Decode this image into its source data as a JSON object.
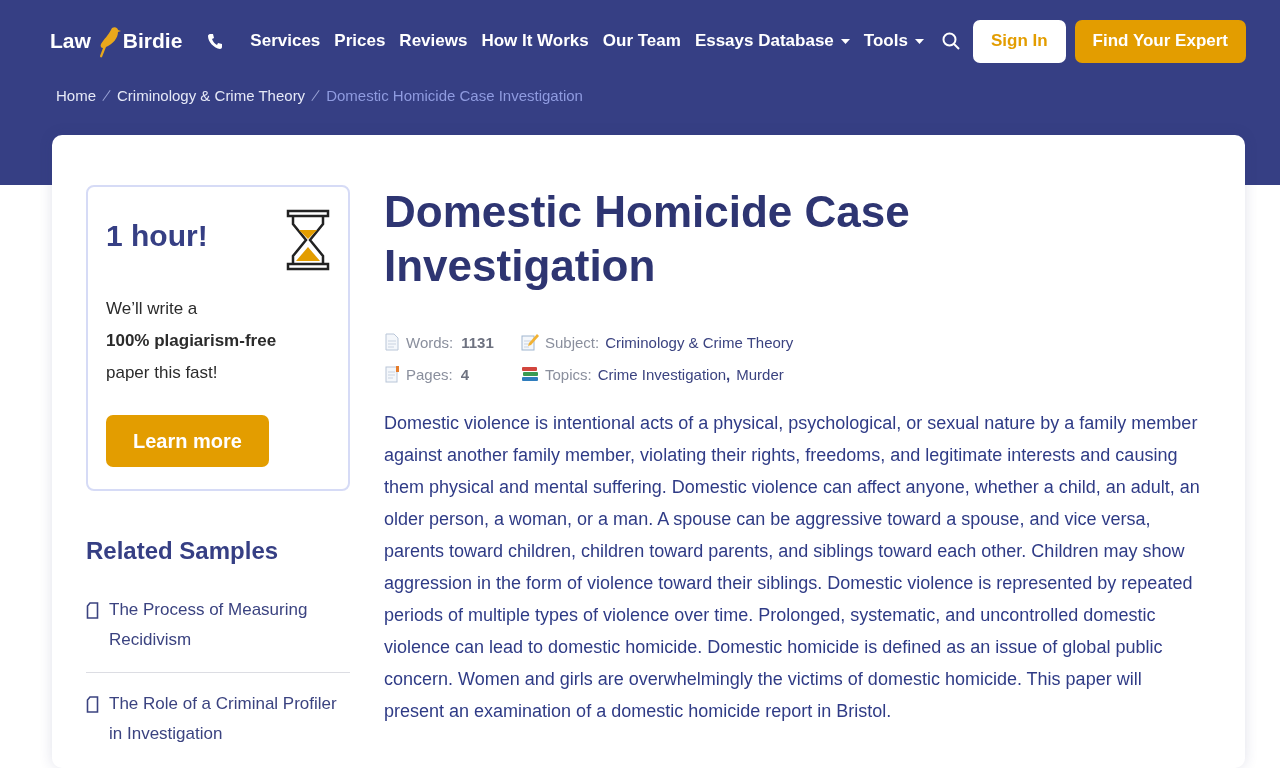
{
  "header": {
    "logo": {
      "left": "Law",
      "right": "Birdie"
    },
    "nav": [
      {
        "label": "Services",
        "dropdown": false
      },
      {
        "label": "Prices",
        "dropdown": false
      },
      {
        "label": "Reviews",
        "dropdown": false
      },
      {
        "label": "How It Works",
        "dropdown": false
      },
      {
        "label": "Our Team",
        "dropdown": false
      },
      {
        "label": "Essays Database",
        "dropdown": true
      },
      {
        "label": "Tools",
        "dropdown": true
      }
    ],
    "buttons": [
      {
        "label": "Sign In",
        "kind": "outline"
      },
      {
        "label": "Find Your Expert",
        "kind": "primary"
      }
    ]
  },
  "breadcrumb": [
    {
      "label": "Home",
      "current": false
    },
    {
      "label": "Criminology & Crime Theory",
      "current": false
    },
    {
      "label": "Domestic Homicide Case Investigation",
      "current": true
    }
  ],
  "promo": {
    "title": "1 hour!",
    "text": "We’ll write a **100% plagiarism-free** paper this fast!",
    "button": "Learn more"
  },
  "related": {
    "title": "Related Samples",
    "items": [
      "The Process of Measuring Recidivism",
      "The Role of a Criminal Profiler in Investigation"
    ]
  },
  "article": {
    "title": "Domestic Homicide Case Investigation",
    "meta": [
      {
        "kind": "words",
        "label": "Words:",
        "value": "1131"
      },
      {
        "kind": "subject",
        "label": "Subject:",
        "links": [
          "Criminology & Crime Theory"
        ]
      },
      {
        "kind": "pages",
        "label": "Pages:",
        "value": "4"
      },
      {
        "kind": "topics",
        "label": "Topics:",
        "links": [
          "Crime Investigation",
          "Murder"
        ],
        "separator": ","
      }
    ],
    "body": "Domestic violence is intentional acts of a physical, psychological, or sexual nature by a family member against another family member, violating their rights, freedoms, and legitimate interests and causing them physical and mental suffering. Domestic violence can affect anyone, whether a child, an adult, an older person, a woman, or a man. A spouse can be aggressive toward a spouse, and vice versa, parents toward children, children toward parents, and siblings toward each other. Children may show aggression in the form of violence toward their siblings. Domestic violence is represented by repeated periods of multiple types of violence over time. Prolonged, systematic, and uncontrolled domestic violence can lead to domestic homicide. Domestic homicide is defined as an issue of global public concern. Women and girls are overwhelmingly the victims of domestic homicide. This paper will present an examination of a domestic homicide report in Bristol."
  }
}
